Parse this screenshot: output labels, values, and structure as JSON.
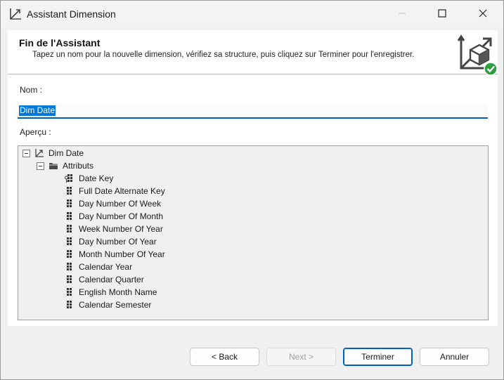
{
  "window": {
    "title": "Assistant Dimension",
    "controls": {
      "minimize_icon": "minimize-icon",
      "maximize_icon": "maximize-icon",
      "close_icon": "close-icon"
    }
  },
  "header": {
    "title": "Fin de l'Assistant",
    "description": "Tapez un nom pour la nouvelle dimension, vérifiez sa structure, puis cliquez sur Terminer pour l'enregistrer.",
    "icon": "dimension-cube-check-icon"
  },
  "form": {
    "name_label": "Nom :",
    "name_value": "Dim Date",
    "preview_label": "Aperçu :"
  },
  "tree": {
    "root": {
      "label": "Dim Date",
      "icon": "dimension-icon"
    },
    "attributes_folder": {
      "label": "Attributs",
      "icon": "folder-icon"
    },
    "attributes": [
      {
        "label": "Date Key",
        "icon": "key-attribute-icon"
      },
      {
        "label": "Full Date Alternate Key",
        "icon": "attribute-icon"
      },
      {
        "label": "Day Number Of Week",
        "icon": "attribute-icon"
      },
      {
        "label": "Day Number Of Month",
        "icon": "attribute-icon"
      },
      {
        "label": "Week Number Of Year",
        "icon": "attribute-icon"
      },
      {
        "label": "Day Number Of Year",
        "icon": "attribute-icon"
      },
      {
        "label": "Month Number Of Year",
        "icon": "attribute-icon"
      },
      {
        "label": "Calendar Year",
        "icon": "attribute-icon"
      },
      {
        "label": "Calendar Quarter",
        "icon": "attribute-icon"
      },
      {
        "label": "English Month Name",
        "icon": "attribute-icon"
      },
      {
        "label": "Calendar Semester",
        "icon": "attribute-icon"
      }
    ]
  },
  "buttons": {
    "back": "< Back",
    "next": "Next >",
    "finish": "Terminer",
    "cancel": "Annuler"
  },
  "colors": {
    "accent": "#005fb8",
    "selection": "#0078d7",
    "success": "#2e9e3e"
  }
}
